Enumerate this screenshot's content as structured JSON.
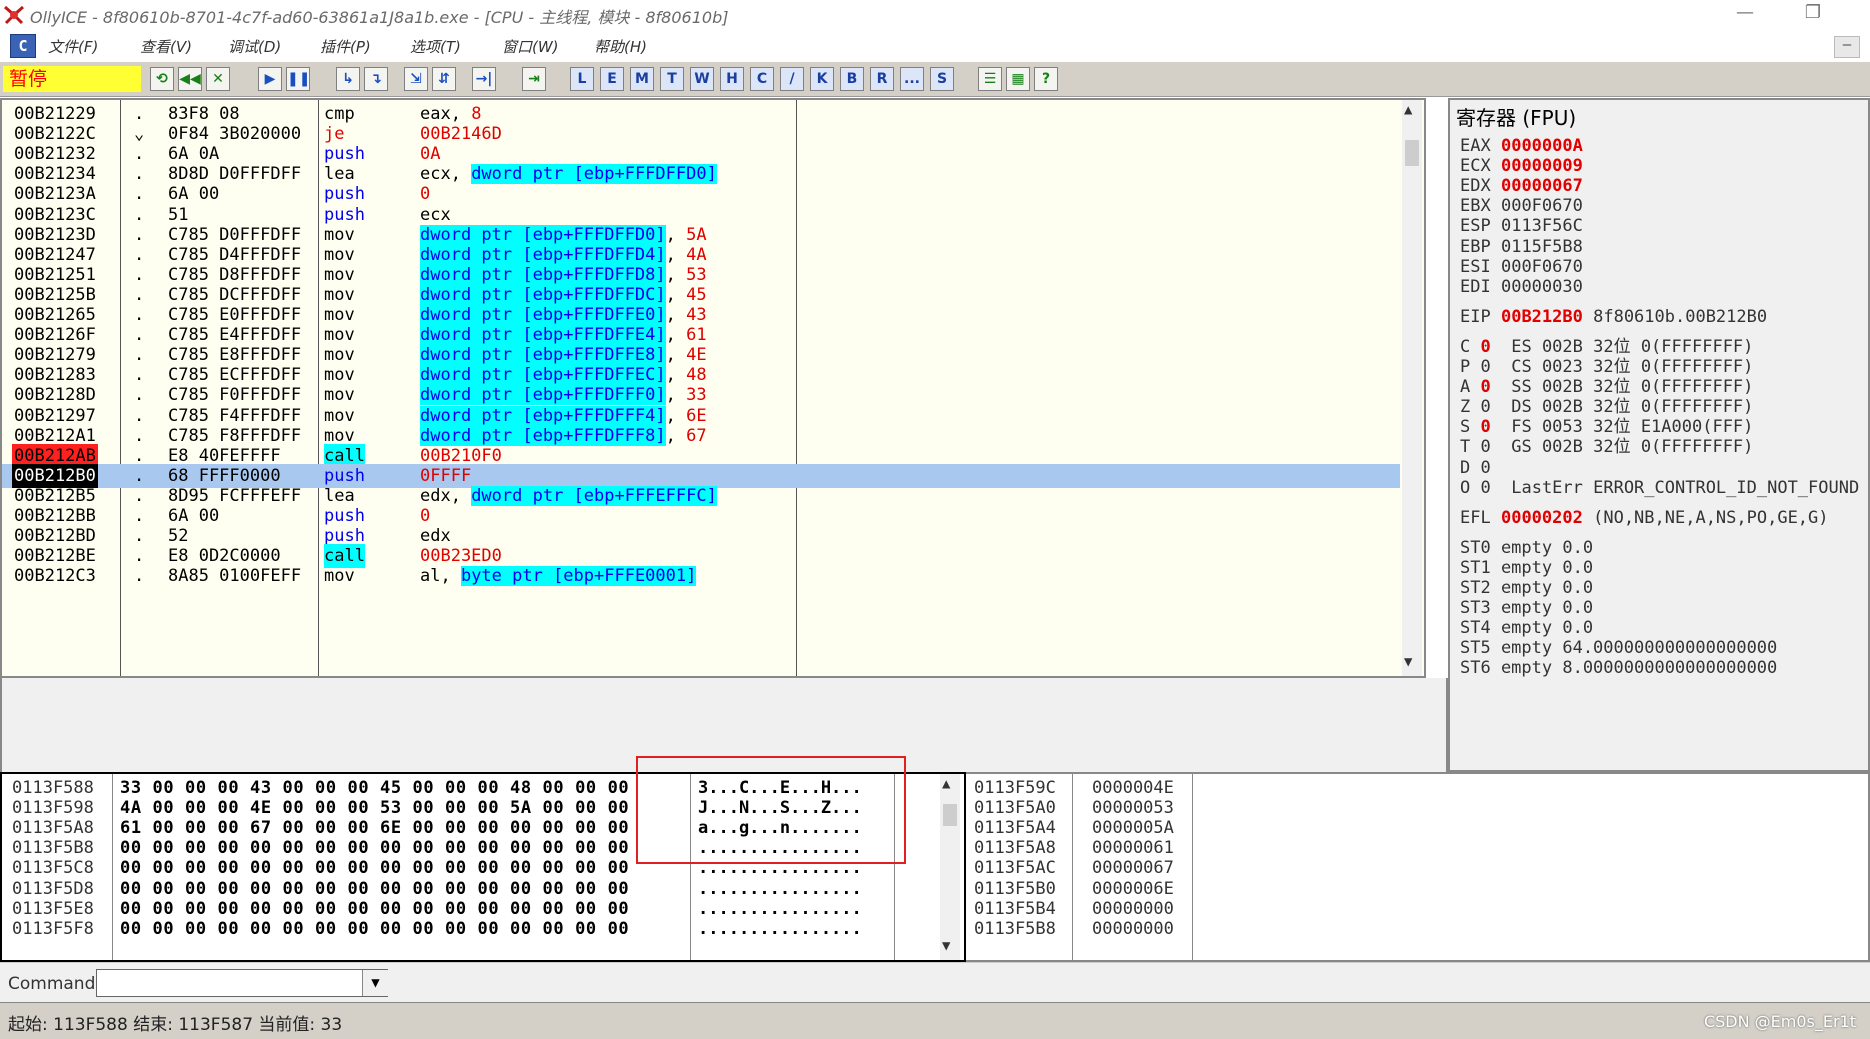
{
  "window": {
    "title": "OllyICE - 8f80610b-8701-4c7f-ad60-63861a1J8a1b.exe - [CPU - 主线程, 模块 - 8f80610b]",
    "minimize_glyph": "—",
    "restore_glyph": "❐"
  },
  "menu": {
    "cpu_icon": "C",
    "items": [
      "文件(F)",
      "查看(V)",
      "调试(D)",
      "插件(P)",
      "选项(T)",
      "窗口(W)",
      "帮助(H)"
    ],
    "min_glyph": "—"
  },
  "toolbar": {
    "status": "暂停",
    "buttons": [
      {
        "glyph": "⟲",
        "name": "restart-icon"
      },
      {
        "glyph": "◀◀",
        "name": "close-program-icon"
      },
      {
        "glyph": "✕",
        "name": "stop-icon"
      },
      {
        "glyph": "▶",
        "name": "run-icon"
      },
      {
        "glyph": "❚❚",
        "name": "pause-icon"
      },
      {
        "glyph": "↳",
        "name": "step-into-icon"
      },
      {
        "glyph": "↴",
        "name": "step-over-icon"
      },
      {
        "glyph": "⇲",
        "name": "trace-into-icon"
      },
      {
        "glyph": "⇵",
        "name": "trace-over-icon"
      },
      {
        "glyph": "→|",
        "name": "execute-till-return-icon"
      },
      {
        "glyph": "⇥",
        "name": "goto-icon"
      }
    ],
    "letters": [
      "L",
      "E",
      "M",
      "T",
      "W",
      "H",
      "C",
      "/",
      "K",
      "B",
      "R",
      "...",
      "S"
    ],
    "extra": [
      {
        "glyph": "☰",
        "name": "list-icon"
      },
      {
        "glyph": "▦",
        "name": "grid-icon"
      },
      {
        "glyph": "?",
        "name": "help-icon"
      }
    ]
  },
  "disasm": {
    "rows": [
      {
        "addr": "00B21229",
        "dot": ".",
        "hex": "83F8 08",
        "mn": "cmp",
        "mn_style": "",
        "op": [
          {
            "t": "eax, ",
            "s": ""
          },
          {
            "t": "8",
            "s": "red"
          }
        ]
      },
      {
        "addr": "00B2122C",
        "dot": "⌄",
        "hex": "0F84 3B020000",
        "mn": "je",
        "mn_style": "red",
        "op": [
          {
            "t": "00B2146D",
            "s": "red"
          }
        ]
      },
      {
        "addr": "00B21232",
        "dot": ".",
        "hex": "6A 0A",
        "mn": "push",
        "mn_style": "blue",
        "op": [
          {
            "t": "0A",
            "s": "red"
          }
        ]
      },
      {
        "addr": "00B21234",
        "dot": ".",
        "hex": "8D8D D0FFFDFF",
        "mn": "lea",
        "mn_style": "",
        "op": [
          {
            "t": "ecx, ",
            "s": ""
          },
          {
            "t": "dword ptr [ebp+FFFDFFD0]",
            "s": "mem"
          }
        ]
      },
      {
        "addr": "00B2123A",
        "dot": ".",
        "hex": "6A 00",
        "mn": "push",
        "mn_style": "blue",
        "op": [
          {
            "t": "0",
            "s": "red"
          }
        ]
      },
      {
        "addr": "00B2123C",
        "dot": ".",
        "hex": "51",
        "mn": "push",
        "mn_style": "blue",
        "op": [
          {
            "t": "ecx",
            "s": ""
          }
        ]
      },
      {
        "addr": "00B2123D",
        "dot": ".",
        "hex": "C785 D0FFFDFF",
        "mn": "mov",
        "mn_style": "",
        "op": [
          {
            "t": "dword ptr [ebp+FFFDFFD0]",
            "s": "mem"
          },
          {
            "t": ", ",
            "s": ""
          },
          {
            "t": "5A",
            "s": "red"
          }
        ]
      },
      {
        "addr": "00B21247",
        "dot": ".",
        "hex": "C785 D4FFFDFF",
        "mn": "mov",
        "mn_style": "",
        "op": [
          {
            "t": "dword ptr [ebp+FFFDFFD4]",
            "s": "mem"
          },
          {
            "t": ", ",
            "s": ""
          },
          {
            "t": "4A",
            "s": "red"
          }
        ]
      },
      {
        "addr": "00B21251",
        "dot": ".",
        "hex": "C785 D8FFFDFF",
        "mn": "mov",
        "mn_style": "",
        "op": [
          {
            "t": "dword ptr [ebp+FFFDFFD8]",
            "s": "mem"
          },
          {
            "t": ", ",
            "s": ""
          },
          {
            "t": "53",
            "s": "red"
          }
        ]
      },
      {
        "addr": "00B2125B",
        "dot": ".",
        "hex": "C785 DCFFFDFF",
        "mn": "mov",
        "mn_style": "",
        "op": [
          {
            "t": "dword ptr [ebp+FFFDFFDC]",
            "s": "mem"
          },
          {
            "t": ", ",
            "s": ""
          },
          {
            "t": "45",
            "s": "red"
          }
        ]
      },
      {
        "addr": "00B21265",
        "dot": ".",
        "hex": "C785 E0FFFDFF",
        "mn": "mov",
        "mn_style": "",
        "op": [
          {
            "t": "dword ptr [ebp+FFFDFFE0]",
            "s": "mem"
          },
          {
            "t": ", ",
            "s": ""
          },
          {
            "t": "43",
            "s": "red"
          }
        ]
      },
      {
        "addr": "00B2126F",
        "dot": ".",
        "hex": "C785 E4FFFDFF",
        "mn": "mov",
        "mn_style": "",
        "op": [
          {
            "t": "dword ptr [ebp+FFFDFFE4]",
            "s": "mem"
          },
          {
            "t": ", ",
            "s": ""
          },
          {
            "t": "61",
            "s": "red"
          }
        ]
      },
      {
        "addr": "00B21279",
        "dot": ".",
        "hex": "C785 E8FFFDFF",
        "mn": "mov",
        "mn_style": "",
        "op": [
          {
            "t": "dword ptr [ebp+FFFDFFE8]",
            "s": "mem"
          },
          {
            "t": ", ",
            "s": ""
          },
          {
            "t": "4E",
            "s": "red"
          }
        ]
      },
      {
        "addr": "00B21283",
        "dot": ".",
        "hex": "C785 ECFFFDFF",
        "mn": "mov",
        "mn_style": "",
        "op": [
          {
            "t": "dword ptr [ebp+FFFDFFEC]",
            "s": "mem"
          },
          {
            "t": ", ",
            "s": ""
          },
          {
            "t": "48",
            "s": "red"
          }
        ]
      },
      {
        "addr": "00B2128D",
        "dot": ".",
        "hex": "C785 F0FFFDFF",
        "mn": "mov",
        "mn_style": "",
        "op": [
          {
            "t": "dword ptr [ebp+FFFDFFF0]",
            "s": "mem"
          },
          {
            "t": ", ",
            "s": ""
          },
          {
            "t": "33",
            "s": "red"
          }
        ]
      },
      {
        "addr": "00B21297",
        "dot": ".",
        "hex": "C785 F4FFFDFF",
        "mn": "mov",
        "mn_style": "",
        "op": [
          {
            "t": "dword ptr [ebp+FFFDFFF4]",
            "s": "mem"
          },
          {
            "t": ", ",
            "s": ""
          },
          {
            "t": "6E",
            "s": "red"
          }
        ]
      },
      {
        "addr": "00B212A1",
        "dot": ".",
        "hex": "C785 F8FFFDFF",
        "mn": "mov",
        "mn_style": "",
        "op": [
          {
            "t": "dword ptr [ebp+FFFDFFF8]",
            "s": "mem"
          },
          {
            "t": ", ",
            "s": ""
          },
          {
            "t": "67",
            "s": "red"
          }
        ]
      },
      {
        "addr": "00B212AB",
        "dot": ".",
        "hex": "E8 40FEFFFF",
        "mn": "call",
        "mn_style": "cyan",
        "op": [
          {
            "t": "00B210F0",
            "s": "red"
          }
        ],
        "addr_style": "bp"
      },
      {
        "addr": "00B212B0",
        "dot": ".",
        "hex": "68 FFFF0000",
        "mn": "push",
        "mn_style": "blue",
        "op": [
          {
            "t": "0FFFF",
            "s": "red"
          }
        ],
        "addr_style": "eip",
        "selected": true
      },
      {
        "addr": "00B212B5",
        "dot": ".",
        "hex": "8D95 FCFFFEFF",
        "mn": "lea",
        "mn_style": "",
        "op": [
          {
            "t": "edx, ",
            "s": ""
          },
          {
            "t": "dword ptr [ebp+FFFEFFFC]",
            "s": "mem"
          }
        ]
      },
      {
        "addr": "00B212BB",
        "dot": ".",
        "hex": "6A 00",
        "mn": "push",
        "mn_style": "blue",
        "op": [
          {
            "t": "0",
            "s": "red"
          }
        ]
      },
      {
        "addr": "00B212BD",
        "dot": ".",
        "hex": "52",
        "mn": "push",
        "mn_style": "blue",
        "op": [
          {
            "t": "edx",
            "s": ""
          }
        ]
      },
      {
        "addr": "00B212BE",
        "dot": ".",
        "hex": "E8 0D2C0000",
        "mn": "call",
        "mn_style": "cyan",
        "op": [
          {
            "t": "00B23ED0",
            "s": "red"
          }
        ]
      },
      {
        "addr": "00B212C3",
        "dot": ".",
        "hex": "8A85 0100FEFF",
        "mn": "mov",
        "mn_style": "",
        "op": [
          {
            "t": "al, ",
            "s": ""
          },
          {
            "t": "byte ptr [ebp+FFFE0001]",
            "s": "mem"
          }
        ]
      }
    ]
  },
  "registers": {
    "header": "寄存器 (FPU)",
    "gp": [
      {
        "name": "EAX",
        "value": "0000000A",
        "changed": true
      },
      {
        "name": "ECX",
        "value": "00000009",
        "changed": true
      },
      {
        "name": "EDX",
        "value": "00000067",
        "changed": true
      },
      {
        "name": "EBX",
        "value": "000F0670",
        "changed": false
      },
      {
        "name": "ESP",
        "value": "0113F56C",
        "changed": false
      },
      {
        "name": "EBP",
        "value": "0115F5B8",
        "changed": false
      },
      {
        "name": "ESI",
        "value": "000F0670",
        "changed": false
      },
      {
        "name": "EDI",
        "value": "00000030",
        "changed": false
      }
    ],
    "eip": {
      "name": "EIP",
      "value": "00B212B0",
      "comment": "8f80610b.00B212B0"
    },
    "flags": [
      {
        "f": "C",
        "v": "0",
        "red": true,
        "seg": "ES 002B 32位 0(FFFFFFFF)"
      },
      {
        "f": "P",
        "v": "0",
        "red": false,
        "seg": "CS 0023 32位 0(FFFFFFFF)"
      },
      {
        "f": "A",
        "v": "0",
        "red": true,
        "seg": "SS 002B 32位 0(FFFFFFFF)"
      },
      {
        "f": "Z",
        "v": "0",
        "red": false,
        "seg": "DS 002B 32位 0(FFFFFFFF)"
      },
      {
        "f": "S",
        "v": "0",
        "red": true,
        "seg": "FS 0053 32位 E1A000(FFF)"
      },
      {
        "f": "T",
        "v": "0",
        "red": false,
        "seg": "GS 002B 32位 0(FFFFFFFF)"
      },
      {
        "f": "D",
        "v": "0",
        "red": false,
        "seg": ""
      },
      {
        "f": "O",
        "v": "0",
        "red": false,
        "seg": "LastErr ERROR_CONTROL_ID_NOT_FOUND"
      }
    ],
    "efl": {
      "name": "EFL",
      "value": "00000202",
      "comment": "(NO,NB,NE,A,NS,PO,GE,G)"
    },
    "fpu": [
      "ST0 empty 0.0",
      "ST1 empty 0.0",
      "ST2 empty 0.0",
      "ST3 empty 0.0",
      "ST4 empty 0.0",
      "ST5 empty 64.000000000000000000",
      "ST6 empty 8.0000000000000000000"
    ]
  },
  "dump": {
    "rows": [
      {
        "addr": "0113F588",
        "hex": "33 00 00 00 43 00 00 00 45 00 00 00 48 00 00 00",
        "ascii": "3...C...E...H..."
      },
      {
        "addr": "0113F598",
        "hex": "4A 00 00 00 4E 00 00 00 53 00 00 00 5A 00 00 00",
        "ascii": "J...N...S...Z..."
      },
      {
        "addr": "0113F5A8",
        "hex": "61 00 00 00 67 00 00 00 6E 00 00 00 00 00 00 00",
        "ascii": "a...g...n......."
      },
      {
        "addr": "0113F5B8",
        "hex": "00 00 00 00 00 00 00 00 00 00 00 00 00 00 00 00",
        "ascii": "................"
      },
      {
        "addr": "0113F5C8",
        "hex": "00 00 00 00 00 00 00 00 00 00 00 00 00 00 00 00",
        "ascii": "................"
      },
      {
        "addr": "0113F5D8",
        "hex": "00 00 00 00 00 00 00 00 00 00 00 00 00 00 00 00",
        "ascii": "................"
      },
      {
        "addr": "0113F5E8",
        "hex": "00 00 00 00 00 00 00 00 00 00 00 00 00 00 00 00",
        "ascii": "................"
      },
      {
        "addr": "0113F5F8",
        "hex": "00 00 00 00 00 00 00 00 00 00 00 00 00 00 00 00",
        "ascii": "................"
      }
    ]
  },
  "stack": {
    "rows": [
      {
        "addr": "0113F59C",
        "val": "0000004E"
      },
      {
        "addr": "0113F5A0",
        "val": "00000053"
      },
      {
        "addr": "0113F5A4",
        "val": "0000005A"
      },
      {
        "addr": "0113F5A8",
        "val": "00000061"
      },
      {
        "addr": "0113F5AC",
        "val": "00000067"
      },
      {
        "addr": "0113F5B0",
        "val": "0000006E"
      },
      {
        "addr": "0113F5B4",
        "val": "00000000"
      },
      {
        "addr": "0113F5B8",
        "val": "00000000"
      }
    ]
  },
  "command": {
    "label": "Command",
    "value": "",
    "dropdown_glyph": "▼"
  },
  "status": {
    "text": "起始: 113F588 结束: 113F587 当前值: 33",
    "watermark": "CSDN @Em0s_Er1t"
  },
  "scroll_glyphs": {
    "up": "▲",
    "down": "▼"
  },
  "colors": {
    "disasm_bg": "#fefff0",
    "toolbar_bg": "#d4d0c8",
    "changed_register": "#e00000",
    "breakpoint": "#ff2020",
    "mem_operand_bg": "#00ffff",
    "selection": "#a8c8f0",
    "highlight_box": "#e02020"
  }
}
